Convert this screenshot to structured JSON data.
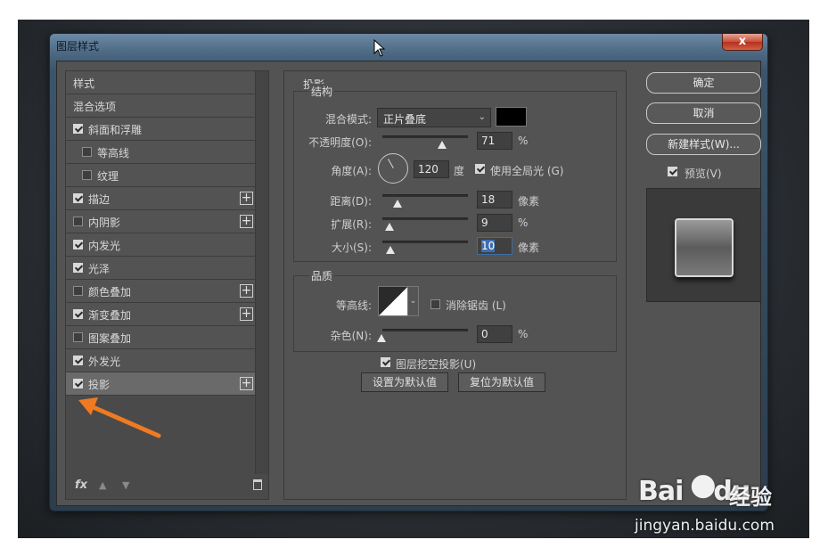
{
  "window": {
    "title": "图层样式",
    "close": "x"
  },
  "styles_list": [
    {
      "label": "样式",
      "checkbox": false,
      "plus": false,
      "indent": 0
    },
    {
      "label": "混合选项",
      "checkbox": false,
      "plus": false,
      "indent": 0
    },
    {
      "label": "斜面和浮雕",
      "checkbox": true,
      "checked": true,
      "plus": false,
      "indent": 0
    },
    {
      "label": "等高线",
      "checkbox": true,
      "checked": false,
      "plus": false,
      "indent": 1
    },
    {
      "label": "纹理",
      "checkbox": true,
      "checked": false,
      "plus": false,
      "indent": 1
    },
    {
      "label": "描边",
      "checkbox": true,
      "checked": true,
      "plus": true,
      "indent": 0
    },
    {
      "label": "内阴影",
      "checkbox": true,
      "checked": false,
      "plus": true,
      "indent": 0
    },
    {
      "label": "内发光",
      "checkbox": true,
      "checked": true,
      "plus": false,
      "indent": 0
    },
    {
      "label": "光泽",
      "checkbox": true,
      "checked": true,
      "plus": false,
      "indent": 0
    },
    {
      "label": "颜色叠加",
      "checkbox": true,
      "checked": false,
      "plus": true,
      "indent": 0
    },
    {
      "label": "渐变叠加",
      "checkbox": true,
      "checked": true,
      "plus": true,
      "indent": 0
    },
    {
      "label": "图案叠加",
      "checkbox": true,
      "checked": false,
      "plus": false,
      "indent": 0
    },
    {
      "label": "外发光",
      "checkbox": true,
      "checked": true,
      "plus": false,
      "indent": 0
    },
    {
      "label": "投影",
      "checkbox": true,
      "checked": true,
      "plus": true,
      "indent": 0,
      "selected": true
    }
  ],
  "footer": {
    "fx": "fx",
    "up": "▲",
    "down": "▼"
  },
  "drop_shadow": {
    "section_title": "投影",
    "structure": {
      "title": "结构",
      "blend_mode_label": "混合模式:",
      "blend_mode_value": "正片叠底",
      "swatch_color": "#000000",
      "opacity_label": "不透明度(O):",
      "opacity_value": "71",
      "opacity_unit": "%",
      "angle_label": "角度(A):",
      "angle_value": "120",
      "angle_unit": "度",
      "global_light_label": "使用全局光 (G)",
      "distance_label": "距离(D):",
      "distance_value": "18",
      "distance_unit": "像素",
      "spread_label": "扩展(R):",
      "spread_value": "9",
      "spread_unit": "%",
      "size_label": "大小(S):",
      "size_value": "10",
      "size_unit": "像素"
    },
    "quality": {
      "title": "品质",
      "contour_label": "等高线:",
      "anti_alias_label": "消除锯齿 (L)",
      "noise_label": "杂色(N):",
      "noise_value": "0",
      "noise_unit": "%"
    },
    "knockout_label": "图层挖空投影(U)",
    "make_default": "设置为默认值",
    "reset_default": "复位为默认值"
  },
  "right": {
    "ok": "确定",
    "cancel": "取消",
    "new_style": "新建样式(W)...",
    "preview_label": "预览(V)"
  },
  "watermark": {
    "brand": "Bai",
    "brand2": "du",
    "cn": "经验",
    "sub": "jingyan.baidu.com"
  }
}
